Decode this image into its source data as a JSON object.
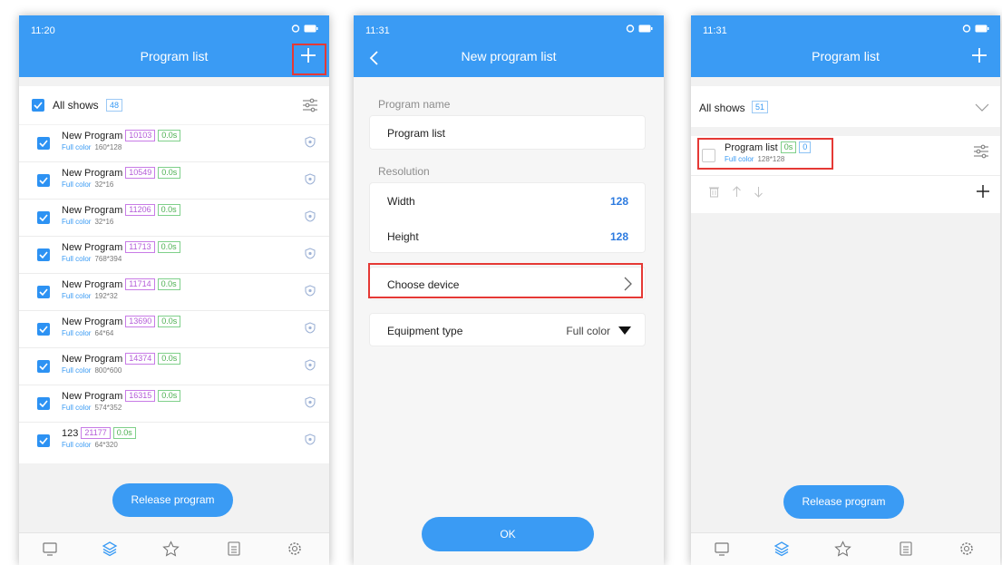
{
  "panel1": {
    "status_time": "11:20",
    "title": "Program list",
    "all_shows_label": "All shows",
    "all_shows_count": "48",
    "programs": [
      {
        "name": "New Program",
        "id": "10103",
        "time": "0.0s",
        "type": "Full color",
        "res": "160*128"
      },
      {
        "name": "New Program",
        "id": "10549",
        "time": "0.0s",
        "type": "Full color",
        "res": "32*16"
      },
      {
        "name": "New Program",
        "id": "11206",
        "time": "0.0s",
        "type": "Full color",
        "res": "32*16"
      },
      {
        "name": "New Program",
        "id": "11713",
        "time": "0.0s",
        "type": "Full color",
        "res": "768*394"
      },
      {
        "name": "New Program",
        "id": "11714",
        "time": "0.0s",
        "type": "Full color",
        "res": "192*32"
      },
      {
        "name": "New Program",
        "id": "13690",
        "time": "0.0s",
        "type": "Full color",
        "res": "64*64"
      },
      {
        "name": "New Program",
        "id": "14374",
        "time": "0.0s",
        "type": "Full color",
        "res": "800*600"
      },
      {
        "name": "New Program",
        "id": "16315",
        "time": "0.0s",
        "type": "Full color",
        "res": "574*352"
      },
      {
        "name": "123",
        "id": "21177",
        "time": "0.0s",
        "type": "Full color",
        "res": "64*320"
      }
    ],
    "release_label": "Release program",
    "icons": [
      "monitor-icon",
      "layers-icon",
      "star-icon",
      "list-icon",
      "settings-icon"
    ]
  },
  "panel2": {
    "status_time": "11:31",
    "title": "New program list",
    "program_name_label": "Program name",
    "program_name_value": "Program list",
    "resolution_label": "Resolution",
    "width_label": "Width",
    "width_value": "128",
    "height_label": "Height",
    "height_value": "128",
    "choose_device_label": "Choose device",
    "equipment_type_label": "Equipment type",
    "equipment_type_value": "Full color",
    "ok_label": "OK"
  },
  "panel3": {
    "status_time": "11:31",
    "title": "Program list",
    "all_shows_label": "All shows",
    "all_shows_count": "51",
    "item": {
      "name": "Program list",
      "time": "0s",
      "count": "0",
      "type": "Full color",
      "res": "128*128"
    },
    "release_label": "Release program"
  },
  "colors": {
    "primary": "#3a9bf4",
    "highlight": "#e53935",
    "id_badge": "#b45bd8",
    "time_badge": "#4caf50"
  }
}
